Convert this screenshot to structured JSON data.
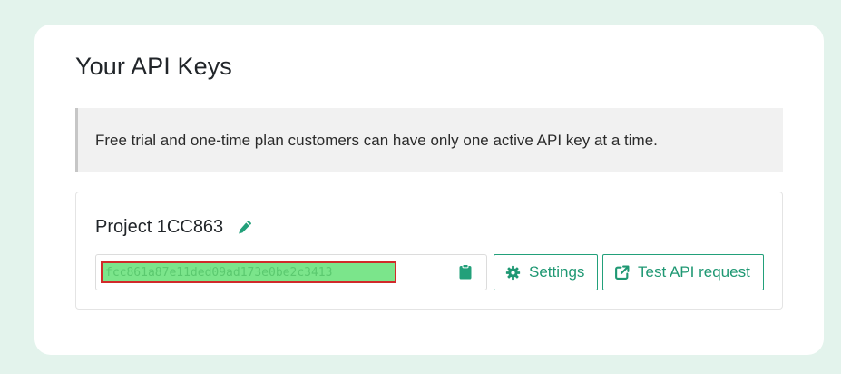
{
  "page": {
    "title": "Your API Keys"
  },
  "notice": {
    "text": "Free trial and one-time plan customers can have only one active API key at a time."
  },
  "project": {
    "name": "Project 1CC863",
    "api_key": "fcc861a87e11ded09ad173e0be2c3413",
    "buttons": {
      "settings_label": "Settings",
      "test_label": "Test API request"
    }
  },
  "icons": {
    "edit": "pencil-icon",
    "copy": "clipboard-icon",
    "settings": "gear-icon",
    "test": "external-link-icon"
  },
  "colors": {
    "accent": "#1f9873",
    "background": "#e3f3ec",
    "key_highlight": "#7be58b",
    "key_outline": "#d12a2a"
  }
}
